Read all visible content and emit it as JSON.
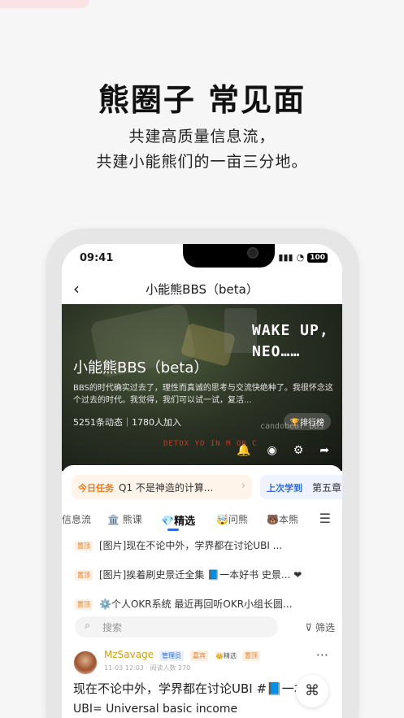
{
  "promo": {
    "headline": "熊圈子 常见面",
    "subline1": "共建高质量信息流，",
    "subline2": "共建小能熊们的一亩三分地。"
  },
  "status_bar": {
    "time": "09:41",
    "battery": "100"
  },
  "nav": {
    "title": "小能熊BBS（beta）",
    "back_icon": "‹"
  },
  "hero": {
    "banner_line1": "WAKE UP,",
    "banner_line2": "NEO……",
    "title": "小能熊BBS（beta）",
    "description": "BBS的时代确实过去了，理性而真诚的思考与交流快绝种了。我很怀念这个过去的时代。我觉得，我们可以试一试，复活...",
    "stats": "5251条动态｜1780人加入",
    "rank_button": "🏆排行榜",
    "watermark": "candobear BBS",
    "detox": "DETOX YO IN M ON C"
  },
  "tasks": {
    "today_label": "今日任务",
    "today_text": "Q1 不是神造的计算...",
    "last_label": "上次学到",
    "last_text": "第五章"
  },
  "tabs": [
    {
      "label": "信息流"
    },
    {
      "label": "🏛️ 熊课"
    },
    {
      "label": "💎精选"
    },
    {
      "label": "🤯问熊"
    },
    {
      "label": "🐻本熊"
    }
  ],
  "pinned": [
    {
      "badge": "置顶",
      "text": "[图片]现在不论中外，学界都在讨论UBI ..."
    },
    {
      "badge": "置顶",
      "text": "[图片]挨着刷史景迁全集 📘一本好书 史景... ❤"
    },
    {
      "badge": "置顶",
      "text": "⚙️个人OKR系统 最近再回听OKR小组长圆..."
    }
  ],
  "search": {
    "placeholder": "搜索",
    "filter_label": "筛选"
  },
  "post": {
    "author": "MzSavage",
    "role_admin": "管理员",
    "role_guest": "嘉宾",
    "role_pick": "精选",
    "role_top": "置顶",
    "meta": "11-03 12:03 · 阅读人数 270",
    "text_line1": "现在不论中外，学界都在讨论UBI #📘一本",
    "text_line2": "UBI= Universal basic income"
  }
}
